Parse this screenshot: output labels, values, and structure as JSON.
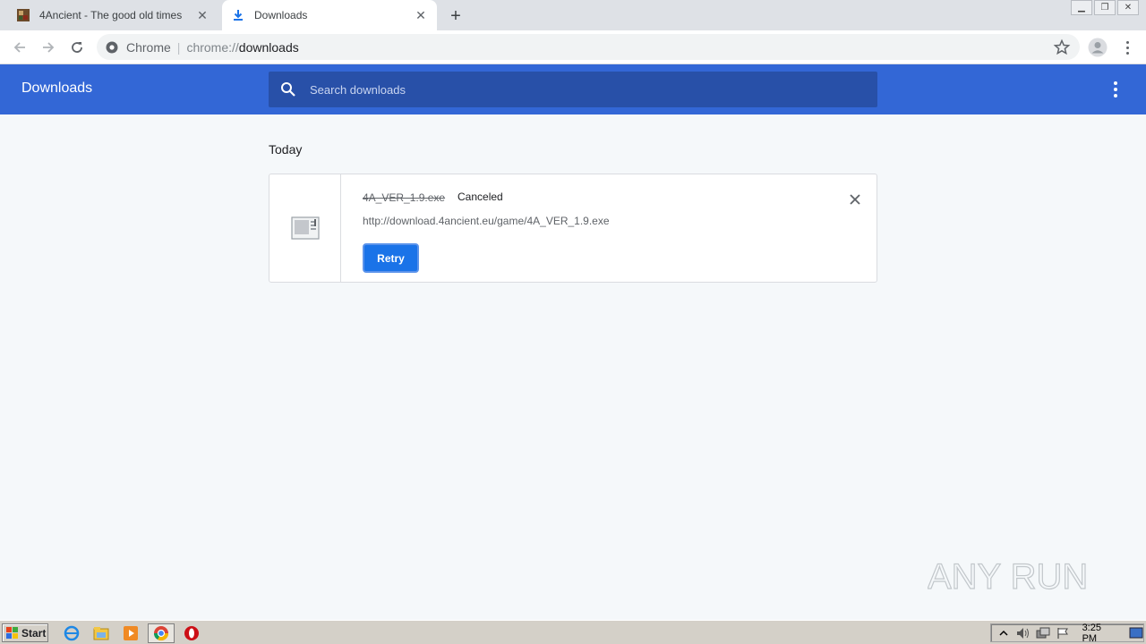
{
  "tabs": [
    {
      "title": "4Ancient - The good old times",
      "favicon": "game-favicon",
      "active": false
    },
    {
      "title": "Downloads",
      "favicon": "download-icon",
      "active": true
    }
  ],
  "toolbar": {
    "chip": "Chrome",
    "url_scheme": "chrome://",
    "url_host": "downloads"
  },
  "header": {
    "title": "Downloads",
    "search_placeholder": "Search downloads"
  },
  "downloads": {
    "section_date": "Today",
    "items": [
      {
        "filename": "4A_VER_1.9.exe",
        "status": "Canceled",
        "url": "http://download.4ancient.eu/game/4A_VER_1.9.exe",
        "retry_label": "Retry"
      }
    ]
  },
  "taskbar": {
    "start_label": "Start",
    "clock": "3:25 PM",
    "pinned": [
      "ie-icon",
      "explorer-icon",
      "media-player-icon",
      "chrome-icon",
      "opera-icon"
    ]
  },
  "watermark": {
    "text": "ANY RUN"
  },
  "colors": {
    "header_blue": "#3367d6",
    "search_blue": "#2850a8",
    "button_blue": "#1a73e8"
  }
}
